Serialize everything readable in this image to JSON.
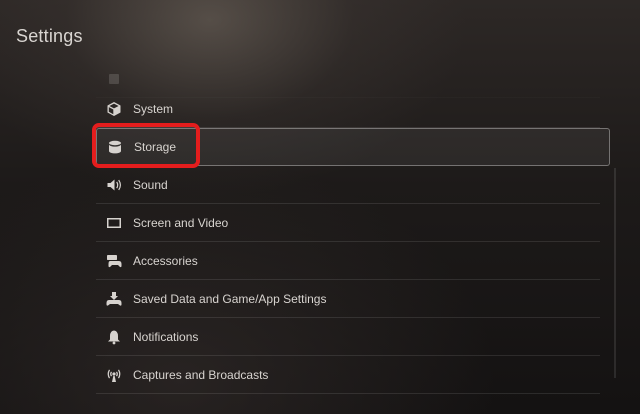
{
  "header": {
    "title": "Settings"
  },
  "menu": {
    "items": [
      {
        "label": "",
        "icon": "partial-hidden-icon"
      },
      {
        "label": "System",
        "icon": "cube-icon"
      },
      {
        "label": "Storage",
        "icon": "database-icon",
        "selected": true
      },
      {
        "label": "Sound",
        "icon": "speaker-icon"
      },
      {
        "label": "Screen and Video",
        "icon": "monitor-icon"
      },
      {
        "label": "Accessories",
        "icon": "controller-keyboard-icon"
      },
      {
        "label": "Saved Data and Game/App Settings",
        "icon": "saved-data-icon"
      },
      {
        "label": "Notifications",
        "icon": "bell-icon"
      },
      {
        "label": "Captures and Broadcasts",
        "icon": "broadcast-icon"
      }
    ]
  },
  "colors": {
    "highlight": "#e41d1d",
    "background": "#1d1a19"
  }
}
